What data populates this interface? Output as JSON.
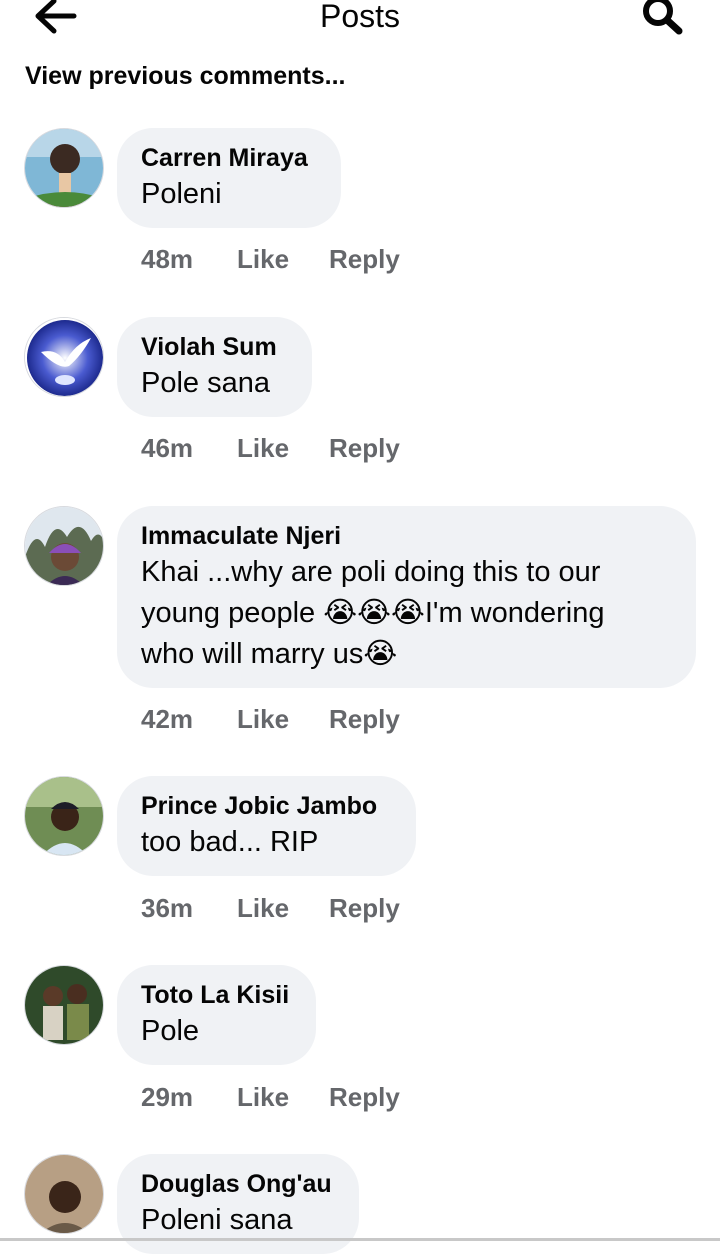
{
  "header": {
    "title": "Posts",
    "back_icon": "arrow-left-icon",
    "search_icon": "search-icon"
  },
  "view_previous": "View previous comments...",
  "comments": [
    {
      "author": "Carren Miraya",
      "lines": [
        "Poleni"
      ],
      "time": "48m",
      "like": "Like",
      "reply": "Reply"
    },
    {
      "author": "Violah Sum",
      "lines": [
        "Pole sana"
      ],
      "time": "46m",
      "like": "Like",
      "reply": "Reply"
    },
    {
      "author": "Immaculate Njeri",
      "lines": [
        "Khai ...why are poli doing this to our",
        "young people 😭😭😭I'm wondering",
        "who will marry us😭"
      ],
      "time": "42m",
      "like": "Like",
      "reply": "Reply"
    },
    {
      "author": "Prince Jobic Jambo",
      "lines": [
        "too bad... RIP"
      ],
      "time": "36m",
      "like": "Like",
      "reply": "Reply"
    },
    {
      "author": "Toto La Kisii",
      "lines": [
        "Pole"
      ],
      "time": "29m",
      "like": "Like",
      "reply": "Reply"
    },
    {
      "author": "Douglas Ong'au",
      "lines": [
        "Poleni sana"
      ],
      "time": "",
      "like": "",
      "reply": ""
    }
  ],
  "colors": {
    "bubble": "#f0f2f5",
    "meta_text": "#65676b",
    "text": "#050505"
  }
}
